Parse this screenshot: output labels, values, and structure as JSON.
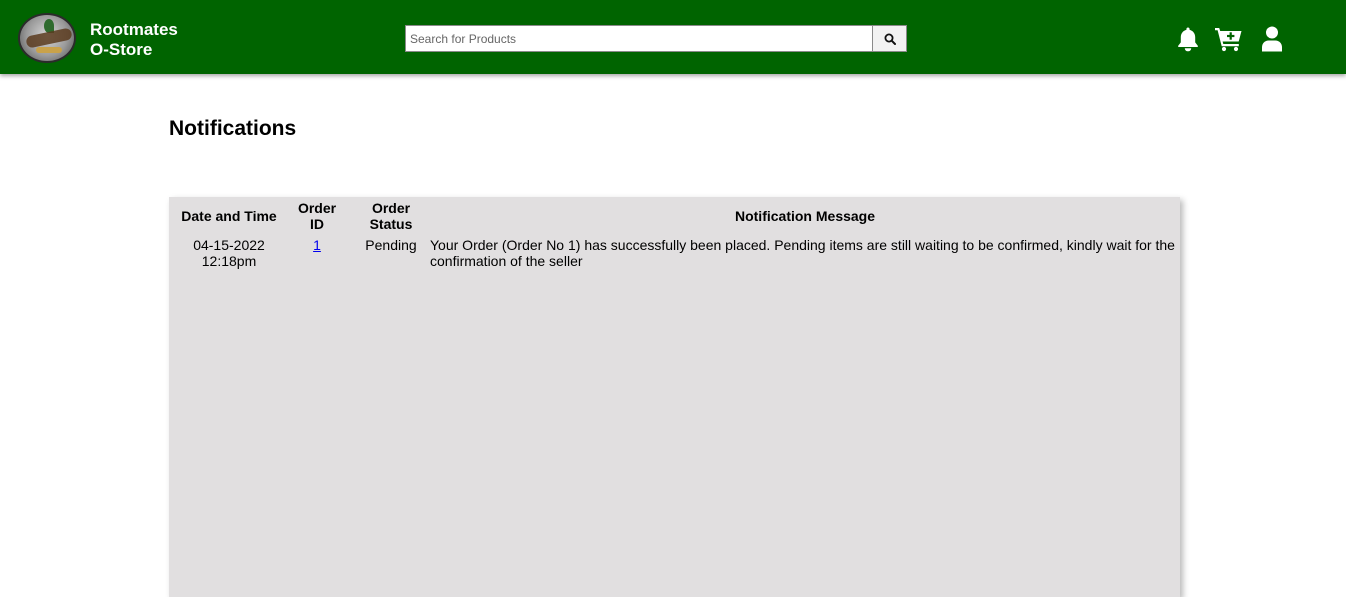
{
  "header": {
    "brand_line1": "Rootmates",
    "brand_line2": "O-Store",
    "search_placeholder": "Search for Products",
    "icons": [
      "bell-icon",
      "cart-plus-icon",
      "user-icon"
    ],
    "bg_color": "#006400"
  },
  "page": {
    "title": "Notifications"
  },
  "table": {
    "headers": {
      "datetime": "Date and Time",
      "order_id_1": "Order",
      "order_id_2": "ID",
      "status_1": "Order",
      "status_2": "Status",
      "message": "Notification Message"
    },
    "rows": [
      {
        "date": "04-15-2022",
        "time": "12:18pm",
        "order_id": "1",
        "status": "Pending",
        "message": "Your Order (Order No 1) has successfully been placed. Pending items are still waiting to be confirmed, kindly wait for the confirmation of the seller"
      }
    ]
  }
}
